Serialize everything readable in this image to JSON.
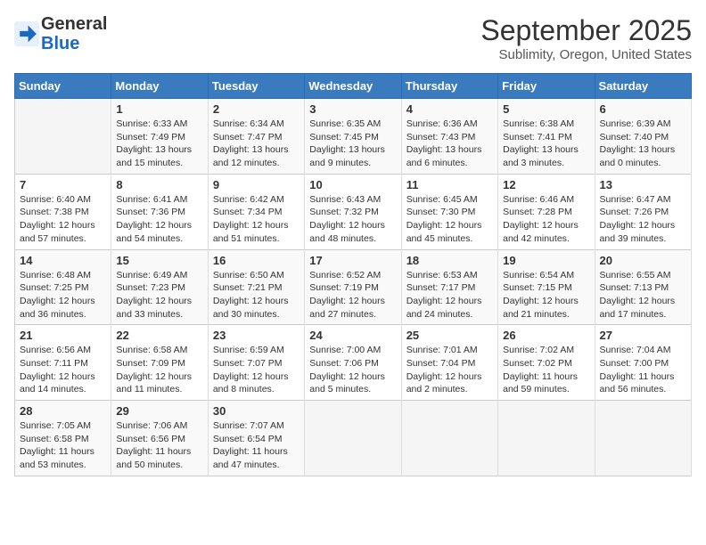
{
  "header": {
    "logo_general": "General",
    "logo_blue": "Blue",
    "month": "September 2025",
    "subtitle": "Sublimity, Oregon, United States"
  },
  "weekdays": [
    "Sunday",
    "Monday",
    "Tuesday",
    "Wednesday",
    "Thursday",
    "Friday",
    "Saturday"
  ],
  "weeks": [
    [
      {
        "day": "",
        "content": ""
      },
      {
        "day": "1",
        "content": "Sunrise: 6:33 AM\nSunset: 7:49 PM\nDaylight: 13 hours\nand 15 minutes."
      },
      {
        "day": "2",
        "content": "Sunrise: 6:34 AM\nSunset: 7:47 PM\nDaylight: 13 hours\nand 12 minutes."
      },
      {
        "day": "3",
        "content": "Sunrise: 6:35 AM\nSunset: 7:45 PM\nDaylight: 13 hours\nand 9 minutes."
      },
      {
        "day": "4",
        "content": "Sunrise: 6:36 AM\nSunset: 7:43 PM\nDaylight: 13 hours\nand 6 minutes."
      },
      {
        "day": "5",
        "content": "Sunrise: 6:38 AM\nSunset: 7:41 PM\nDaylight: 13 hours\nand 3 minutes."
      },
      {
        "day": "6",
        "content": "Sunrise: 6:39 AM\nSunset: 7:40 PM\nDaylight: 13 hours\nand 0 minutes."
      }
    ],
    [
      {
        "day": "7",
        "content": "Sunrise: 6:40 AM\nSunset: 7:38 PM\nDaylight: 12 hours\nand 57 minutes."
      },
      {
        "day": "8",
        "content": "Sunrise: 6:41 AM\nSunset: 7:36 PM\nDaylight: 12 hours\nand 54 minutes."
      },
      {
        "day": "9",
        "content": "Sunrise: 6:42 AM\nSunset: 7:34 PM\nDaylight: 12 hours\nand 51 minutes."
      },
      {
        "day": "10",
        "content": "Sunrise: 6:43 AM\nSunset: 7:32 PM\nDaylight: 12 hours\nand 48 minutes."
      },
      {
        "day": "11",
        "content": "Sunrise: 6:45 AM\nSunset: 7:30 PM\nDaylight: 12 hours\nand 45 minutes."
      },
      {
        "day": "12",
        "content": "Sunrise: 6:46 AM\nSunset: 7:28 PM\nDaylight: 12 hours\nand 42 minutes."
      },
      {
        "day": "13",
        "content": "Sunrise: 6:47 AM\nSunset: 7:26 PM\nDaylight: 12 hours\nand 39 minutes."
      }
    ],
    [
      {
        "day": "14",
        "content": "Sunrise: 6:48 AM\nSunset: 7:25 PM\nDaylight: 12 hours\nand 36 minutes."
      },
      {
        "day": "15",
        "content": "Sunrise: 6:49 AM\nSunset: 7:23 PM\nDaylight: 12 hours\nand 33 minutes."
      },
      {
        "day": "16",
        "content": "Sunrise: 6:50 AM\nSunset: 7:21 PM\nDaylight: 12 hours\nand 30 minutes."
      },
      {
        "day": "17",
        "content": "Sunrise: 6:52 AM\nSunset: 7:19 PM\nDaylight: 12 hours\nand 27 minutes."
      },
      {
        "day": "18",
        "content": "Sunrise: 6:53 AM\nSunset: 7:17 PM\nDaylight: 12 hours\nand 24 minutes."
      },
      {
        "day": "19",
        "content": "Sunrise: 6:54 AM\nSunset: 7:15 PM\nDaylight: 12 hours\nand 21 minutes."
      },
      {
        "day": "20",
        "content": "Sunrise: 6:55 AM\nSunset: 7:13 PM\nDaylight: 12 hours\nand 17 minutes."
      }
    ],
    [
      {
        "day": "21",
        "content": "Sunrise: 6:56 AM\nSunset: 7:11 PM\nDaylight: 12 hours\nand 14 minutes."
      },
      {
        "day": "22",
        "content": "Sunrise: 6:58 AM\nSunset: 7:09 PM\nDaylight: 12 hours\nand 11 minutes."
      },
      {
        "day": "23",
        "content": "Sunrise: 6:59 AM\nSunset: 7:07 PM\nDaylight: 12 hours\nand 8 minutes."
      },
      {
        "day": "24",
        "content": "Sunrise: 7:00 AM\nSunset: 7:06 PM\nDaylight: 12 hours\nand 5 minutes."
      },
      {
        "day": "25",
        "content": "Sunrise: 7:01 AM\nSunset: 7:04 PM\nDaylight: 12 hours\nand 2 minutes."
      },
      {
        "day": "26",
        "content": "Sunrise: 7:02 AM\nSunset: 7:02 PM\nDaylight: 11 hours\nand 59 minutes."
      },
      {
        "day": "27",
        "content": "Sunrise: 7:04 AM\nSunset: 7:00 PM\nDaylight: 11 hours\nand 56 minutes."
      }
    ],
    [
      {
        "day": "28",
        "content": "Sunrise: 7:05 AM\nSunset: 6:58 PM\nDaylight: 11 hours\nand 53 minutes."
      },
      {
        "day": "29",
        "content": "Sunrise: 7:06 AM\nSunset: 6:56 PM\nDaylight: 11 hours\nand 50 minutes."
      },
      {
        "day": "30",
        "content": "Sunrise: 7:07 AM\nSunset: 6:54 PM\nDaylight: 11 hours\nand 47 minutes."
      },
      {
        "day": "",
        "content": ""
      },
      {
        "day": "",
        "content": ""
      },
      {
        "day": "",
        "content": ""
      },
      {
        "day": "",
        "content": ""
      }
    ]
  ]
}
